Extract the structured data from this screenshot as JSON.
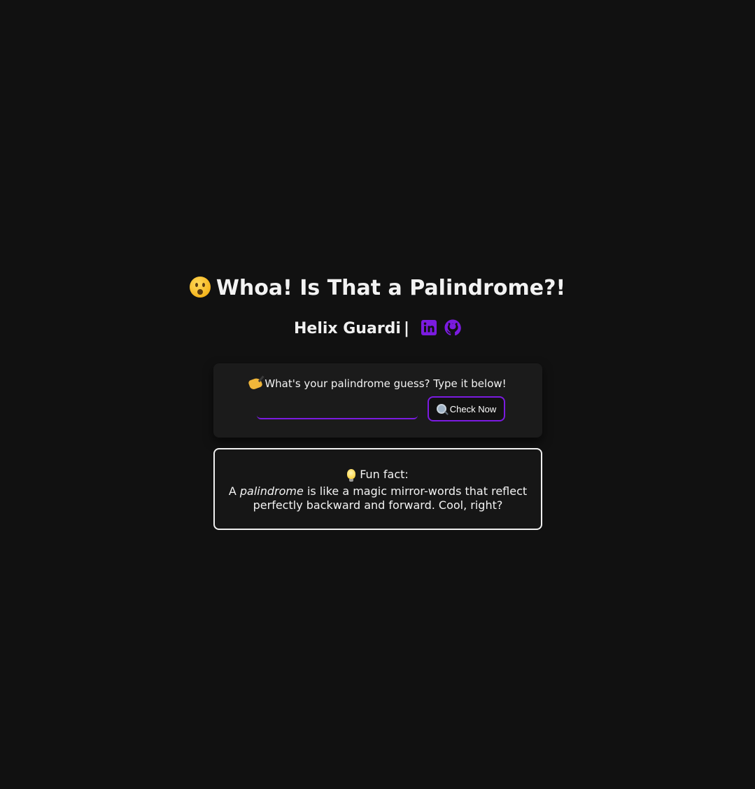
{
  "header": {
    "title": "Whoa! Is That a Palindrome?!",
    "title_emoji": "hushed-face",
    "author": "Helix Guardi",
    "separator": "|",
    "links": [
      {
        "icon": "linkedin-icon",
        "color": "#7b1be0"
      },
      {
        "icon": "github-icon",
        "color": "#7b1be0"
      }
    ]
  },
  "form": {
    "prompt_icon": "writing-hand",
    "prompt": "What's your palindrome guess? Type it below!",
    "input_value": "",
    "input_placeholder": "",
    "button_icon": "magnifier",
    "button_label": "Check Now"
  },
  "fact": {
    "icon": "light-bulb",
    "title": "Fun fact:",
    "text_prefix": "A",
    "text_emphasis": "palindrome",
    "text_suffix": "is like a magic mirror-words that reflect perfectly backward and forward. Cool, right?"
  },
  "colors": {
    "background": "#111111",
    "accent": "#7b1be0",
    "card": "#1b1b1b"
  }
}
